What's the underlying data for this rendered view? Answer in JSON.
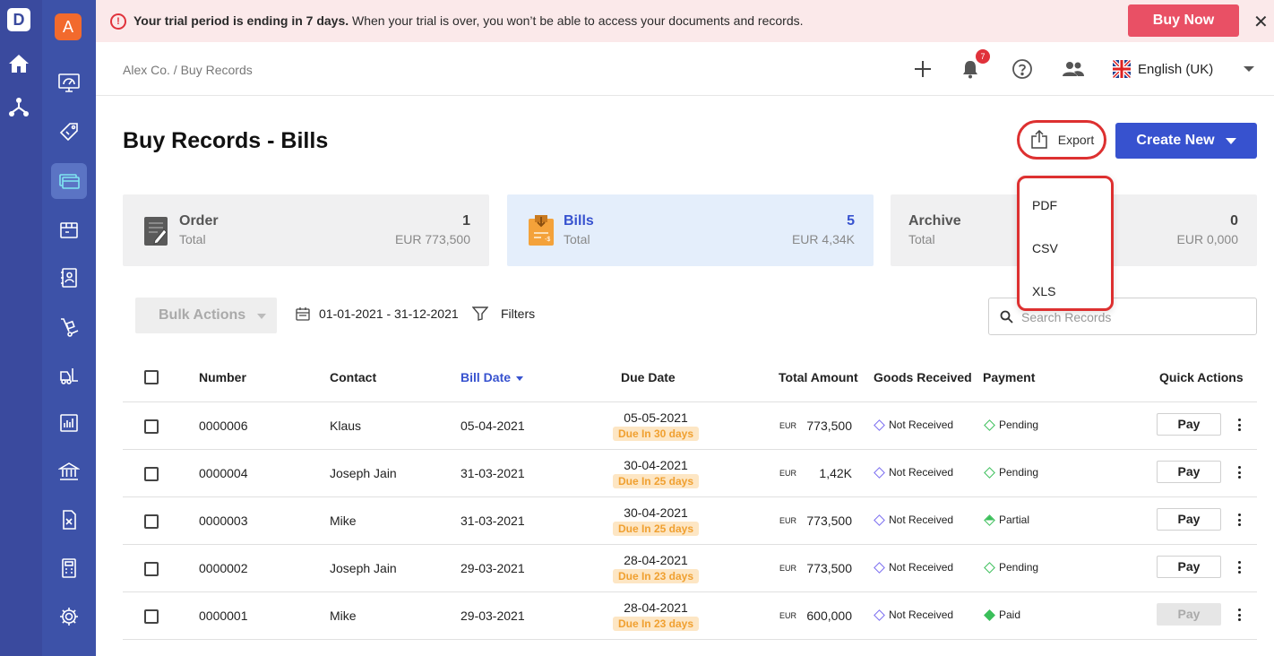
{
  "rail": {
    "logo": "D",
    "icons": [
      "home-icon",
      "workflow-icon"
    ]
  },
  "sidebar": {
    "avatar": "A",
    "items": [
      {
        "name": "dashboard-icon",
        "active": false
      },
      {
        "name": "sales-tag-icon",
        "active": false
      },
      {
        "name": "buy-records-icon",
        "active": true
      },
      {
        "name": "inventory-box-icon",
        "active": false
      },
      {
        "name": "contacts-book-icon",
        "active": false
      },
      {
        "name": "hand-truck-icon",
        "active": false
      },
      {
        "name": "forklift-icon",
        "active": false
      },
      {
        "name": "reports-chart-icon",
        "active": false
      },
      {
        "name": "bank-icon",
        "active": false
      },
      {
        "name": "tax-calculator-icon",
        "active": false
      },
      {
        "name": "calculator-icon",
        "active": false
      },
      {
        "name": "settings-gear-icon",
        "active": false
      }
    ]
  },
  "trial_banner": {
    "bold": "Your trial period is ending in 7 days.",
    "text": " When your trial is over, you won’t be able to access your documents and records.",
    "buy_label": "Buy Now",
    "close": "✕"
  },
  "topbar": {
    "breadcrumb": "Alex Co. / Buy Records",
    "notification_count": "7",
    "language": "English (UK)"
  },
  "page": {
    "title": "Buy Records - Bills",
    "export_label": "Export",
    "create_label": "Create New"
  },
  "export_menu": {
    "items": [
      "PDF",
      "CSV",
      "XLS"
    ]
  },
  "cards": [
    {
      "name": "Order",
      "sub": "Total",
      "count": "1",
      "amount": "EUR 773,500"
    },
    {
      "name": "Bills",
      "sub": "Total",
      "count": "5",
      "amount": "EUR 4,34K"
    },
    {
      "name": "Archive",
      "sub": "Total",
      "count": "0",
      "amount": "EUR 0,000"
    }
  ],
  "toolbar": {
    "bulk_label": "Bulk Actions",
    "date_range": "01-01-2021 - 31-12-2021",
    "filters_label": "Filters",
    "search_placeholder": "Search Records"
  },
  "table": {
    "headers": {
      "number": "Number",
      "contact": "Contact",
      "bill_date": "Bill Date",
      "due_date": "Due Date",
      "total": "Total Amount",
      "goods": "Goods Received",
      "payment": "Payment",
      "quick": "Quick Actions"
    },
    "rows": [
      {
        "number": "0000006",
        "contact": "Klaus",
        "bill_date": "05-04-2021",
        "due_date": "05-05-2021",
        "due_tag": "Due In 30 days",
        "currency": "EUR",
        "amount": "773,500",
        "goods": "Not Received",
        "payment": "Pending",
        "payment_style": "green",
        "pay_label": "Pay",
        "pay_disabled": false
      },
      {
        "number": "0000004",
        "contact": "Joseph Jain",
        "bill_date": "31-03-2021",
        "due_date": "30-04-2021",
        "due_tag": "Due In 25 days",
        "currency": "EUR",
        "amount": "1,42K",
        "goods": "Not Received",
        "payment": "Pending",
        "payment_style": "green",
        "pay_label": "Pay",
        "pay_disabled": false
      },
      {
        "number": "0000003",
        "contact": "Mike",
        "bill_date": "31-03-2021",
        "due_date": "30-04-2021",
        "due_tag": "Due In 25 days",
        "currency": "EUR",
        "amount": "773,500",
        "goods": "Not Received",
        "payment": "Partial",
        "payment_style": "green-half",
        "pay_label": "Pay",
        "pay_disabled": false
      },
      {
        "number": "0000002",
        "contact": "Joseph Jain",
        "bill_date": "29-03-2021",
        "due_date": "28-04-2021",
        "due_tag": "Due In 23 days",
        "currency": "EUR",
        "amount": "773,500",
        "goods": "Not Received",
        "payment": "Pending",
        "payment_style": "green",
        "pay_label": "Pay",
        "pay_disabled": false
      },
      {
        "number": "0000001",
        "contact": "Mike",
        "bill_date": "29-03-2021",
        "due_date": "28-04-2021",
        "due_tag": "Due In 23 days",
        "currency": "EUR",
        "amount": "600,000",
        "goods": "Not Received",
        "payment": "Paid",
        "payment_style": "green-full",
        "pay_label": "Pay",
        "pay_disabled": true
      }
    ]
  }
}
